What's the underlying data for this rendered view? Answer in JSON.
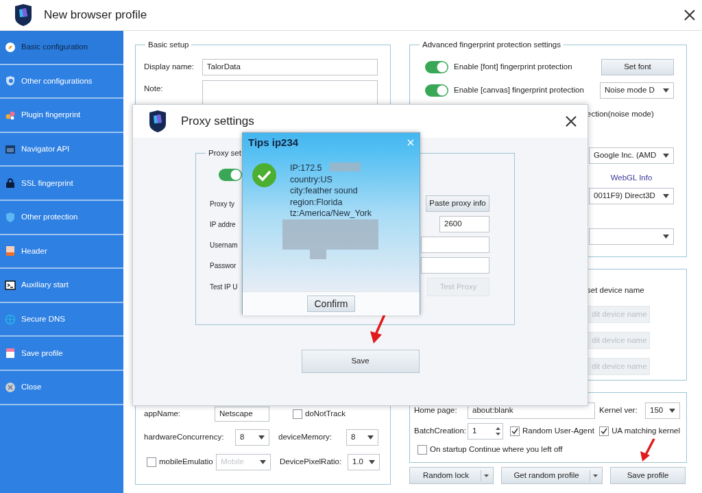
{
  "window": {
    "title": "New browser profile"
  },
  "sidebar": {
    "items": [
      {
        "label": "Basic configuration",
        "selected": true
      },
      {
        "label": "Other configurations",
        "selected": false
      },
      {
        "label": "Plugin fingerprint",
        "selected": false
      },
      {
        "label": "Navigator API",
        "selected": false
      },
      {
        "label": "SSL fingerprint",
        "selected": false
      },
      {
        "label": "Other protection",
        "selected": false
      },
      {
        "label": "Header",
        "selected": false
      },
      {
        "label": "Auxiliary start",
        "selected": false
      },
      {
        "label": "Secure DNS",
        "selected": false
      },
      {
        "label": "Save profile",
        "selected": false
      },
      {
        "label": "Close",
        "selected": false
      }
    ]
  },
  "basic_setup": {
    "legend": "Basic setup",
    "display_name_label": "Display name:",
    "display_name_value": "TalorData",
    "note_label": "Note:"
  },
  "navigator": {
    "app_name_label": "appName:",
    "app_name_value": "Netscape",
    "do_not_track": {
      "label": "doNotTrack",
      "checked": false
    },
    "hardware_concurrency_label": "hardwareConcurrency:",
    "hardware_concurrency_value": "8",
    "device_memory_label": "deviceMemory:",
    "device_memory_value": "8",
    "mobile_emulation": {
      "label": "mobileEmulatio",
      "checked": false
    },
    "mobile_select": {
      "value": "Mobile",
      "disabled": true
    },
    "pixel_ratio_label": "DevicePixelRatio:",
    "pixel_ratio_value": "1.0"
  },
  "advanced": {
    "legend": "Advanced fingerprint protection settings",
    "toggles": [
      {
        "label": "Enable [font] fingerprint protection",
        "on": true
      },
      {
        "label": "Enable [canvas] fingerprint protection",
        "on": true
      }
    ],
    "set_font_button": "Set font",
    "noise_mode": "Noise mode D",
    "webgl_mode_text": "ection(noise mode)",
    "webgl_vendor": "Google Inc. (AMD",
    "webgl_info_link": "WebGL Info",
    "webgl_renderer": "0011F9) Direct3D"
  },
  "device_names": {
    "checkbox_label": "set device name",
    "buttons": [
      {
        "label": "dit device name",
        "disabled": true
      },
      {
        "label": "dit device name",
        "disabled": true
      },
      {
        "label": "dit device name",
        "disabled": true
      }
    ]
  },
  "startup": {
    "home_page_label": "Home page:",
    "home_page_value": "about:blank",
    "kernel_label": "Kernel ver:",
    "kernel_value": "150",
    "batch_label": "BatchCreation:",
    "batch_value": "1",
    "checkboxes": [
      {
        "label": "Random User-Agent",
        "checked": true
      },
      {
        "label": "UA matching kernel",
        "checked": true
      },
      {
        "label": "On startup Continue where you left off",
        "checked": false
      }
    ]
  },
  "footer_buttons": [
    {
      "label": "Random lock",
      "kind": "split"
    },
    {
      "label": "Get random profile",
      "kind": "split"
    },
    {
      "label": "Save profile",
      "kind": "plain"
    }
  ],
  "proxy_dialog": {
    "title": "Proxy settings",
    "legend": "Proxy set",
    "toggle_on": true,
    "labels": [
      "Proxy ty",
      "IP addre",
      "Usernam",
      "Passwor",
      "Test IP U"
    ],
    "paste_button": "Paste proxy info",
    "port_value": "2600",
    "test_button": {
      "label": "Test Proxy",
      "disabled": true
    },
    "save_button": "Save"
  },
  "tips_dialog": {
    "title": "Tips ip234",
    "lines": [
      "IP:172.5",
      "country:US",
      "city:feather sound",
      "region:Florida",
      "tz:America/New_York"
    ],
    "confirm_button": "Confirm"
  }
}
